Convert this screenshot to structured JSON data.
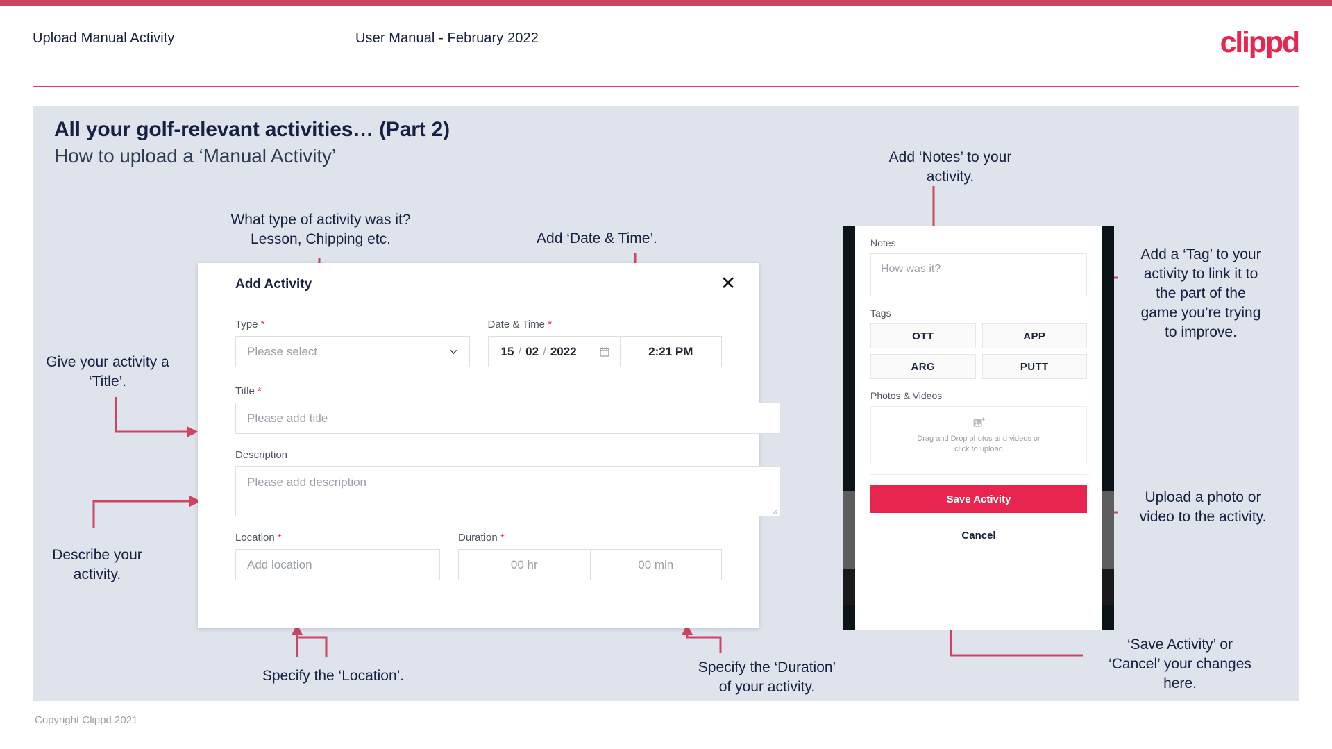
{
  "header": {
    "title": "Upload Manual Activity",
    "subtitle": "User Manual - February 2022",
    "brand": "clippd",
    "accent_color": "#e8254f",
    "bar_color": "#cf4462"
  },
  "slide": {
    "title": "All your golf-relevant activities… (Part 2)",
    "subtitle": "How to upload a ‘Manual Activity’",
    "background_color": "#dfe3ec"
  },
  "annotations": {
    "type": "What type of activity was it?\nLesson, Chipping etc.",
    "datetime": "Add ‘Date & Time’.",
    "title": "Give your activity a\n‘Title’.",
    "description": "Describe your\nactivity.",
    "location": "Specify the ‘Location’.",
    "duration": "Specify the ‘Duration’\nof your activity.",
    "notes": "Add ‘Notes’ to your\nactivity.",
    "tags": "Add a ‘Tag’ to your\nactivity to link it to\nthe part of the\ngame you’re trying\nto improve.",
    "photos": "Upload a photo or\nvideo to the activity.",
    "save": "‘Save Activity’ or\n‘Cancel’ your changes\nhere."
  },
  "dialog": {
    "title": "Add Activity",
    "close_icon": "close-icon",
    "fields": {
      "type": {
        "label": "Type",
        "required": "*",
        "placeholder": "Please select",
        "chevron_icon": "chevron-down-icon"
      },
      "datetime": {
        "label": "Date & Time",
        "required": "*",
        "day": "15",
        "sep1": "/",
        "month": "02",
        "sep2": "/",
        "year": "2022",
        "calendar_icon": "calendar-icon",
        "time": "2:21 PM"
      },
      "title": {
        "label": "Title",
        "required": "*",
        "placeholder": "Please add title"
      },
      "description": {
        "label": "Description",
        "required": "",
        "placeholder": "Please add description"
      },
      "location": {
        "label": "Location",
        "required": "*",
        "placeholder": "Add location"
      },
      "duration": {
        "label": "Duration",
        "required": "*",
        "hours_placeholder": "00 hr",
        "minutes_placeholder": "00 min"
      }
    }
  },
  "phone": {
    "notes": {
      "label": "Notes",
      "placeholder": "How was it?"
    },
    "tags": {
      "label": "Tags",
      "items": [
        "OTT",
        "APP",
        "ARG",
        "PUTT"
      ]
    },
    "photos": {
      "label": "Photos & Videos",
      "icon": "add-image-icon",
      "dropzone_line1": "Drag and Drop photos and videos or",
      "dropzone_line2": "click to upload"
    },
    "save_label": "Save Activity",
    "cancel_label": "Cancel",
    "save_color": "#e8254f"
  },
  "footer": {
    "copyright": "Copyright Clippd 2021"
  }
}
